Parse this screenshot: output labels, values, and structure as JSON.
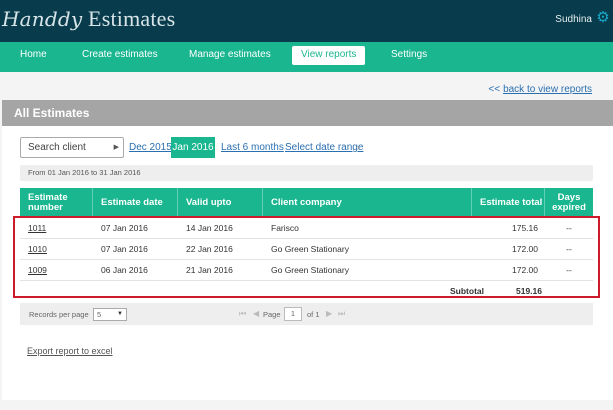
{
  "app": {
    "logo_script": "Handdy",
    "logo_text": " Estimates",
    "user_name": "Sudhina",
    "settings_icon": "gear-icon"
  },
  "nav": {
    "home": "Home",
    "create": "Create estimates",
    "manage": "Manage estimates",
    "view_reports": "View reports",
    "settings": "Settings",
    "active": "View reports"
  },
  "back_link": {
    "arrows": "<<",
    "label": "back to view reports"
  },
  "report": {
    "title": "All Estimates",
    "search_client": "Search client",
    "filters": {
      "dec_2015": "Dec 2015",
      "jan_2016": "Jan 2016",
      "last_6_months": "Last 6 months",
      "select_range": "Select date range"
    },
    "range_text": "From 01 Jan 2016 to 31 Jan 2016",
    "columns": {
      "number": "Estimate number",
      "date": "Estimate date",
      "valid": "Valid upto",
      "client": "Client company",
      "total": "Estimate total",
      "days_expired": "Days expired"
    },
    "rows": [
      {
        "number": "1011",
        "date": "07 Jan 2016",
        "valid": "14 Jan 2016",
        "client": "Farisco",
        "total": "175.16",
        "days": "--"
      },
      {
        "number": "1010",
        "date": "07 Jan 2016",
        "valid": "22 Jan 2016",
        "client": "Go Green Stationary",
        "total": "172.00",
        "days": "--"
      },
      {
        "number": "1009",
        "date": "06 Jan 2016",
        "valid": "21 Jan 2016",
        "client": "Go Green Stationary",
        "total": "172.00",
        "days": "--"
      }
    ],
    "subtotal_label": "Subtotal",
    "subtotal_value": "519.16",
    "highlight_color": "#cc1c2a"
  },
  "pager": {
    "rpp_label": "Records per page",
    "rpp_value": "5",
    "page_label": "Page",
    "page_value": "1",
    "of_label": "of 1"
  },
  "export_label": "Export report to excel",
  "colors": {
    "topbar": "#083c4c",
    "accent": "#19b68f",
    "link": "#2a6fb0"
  }
}
